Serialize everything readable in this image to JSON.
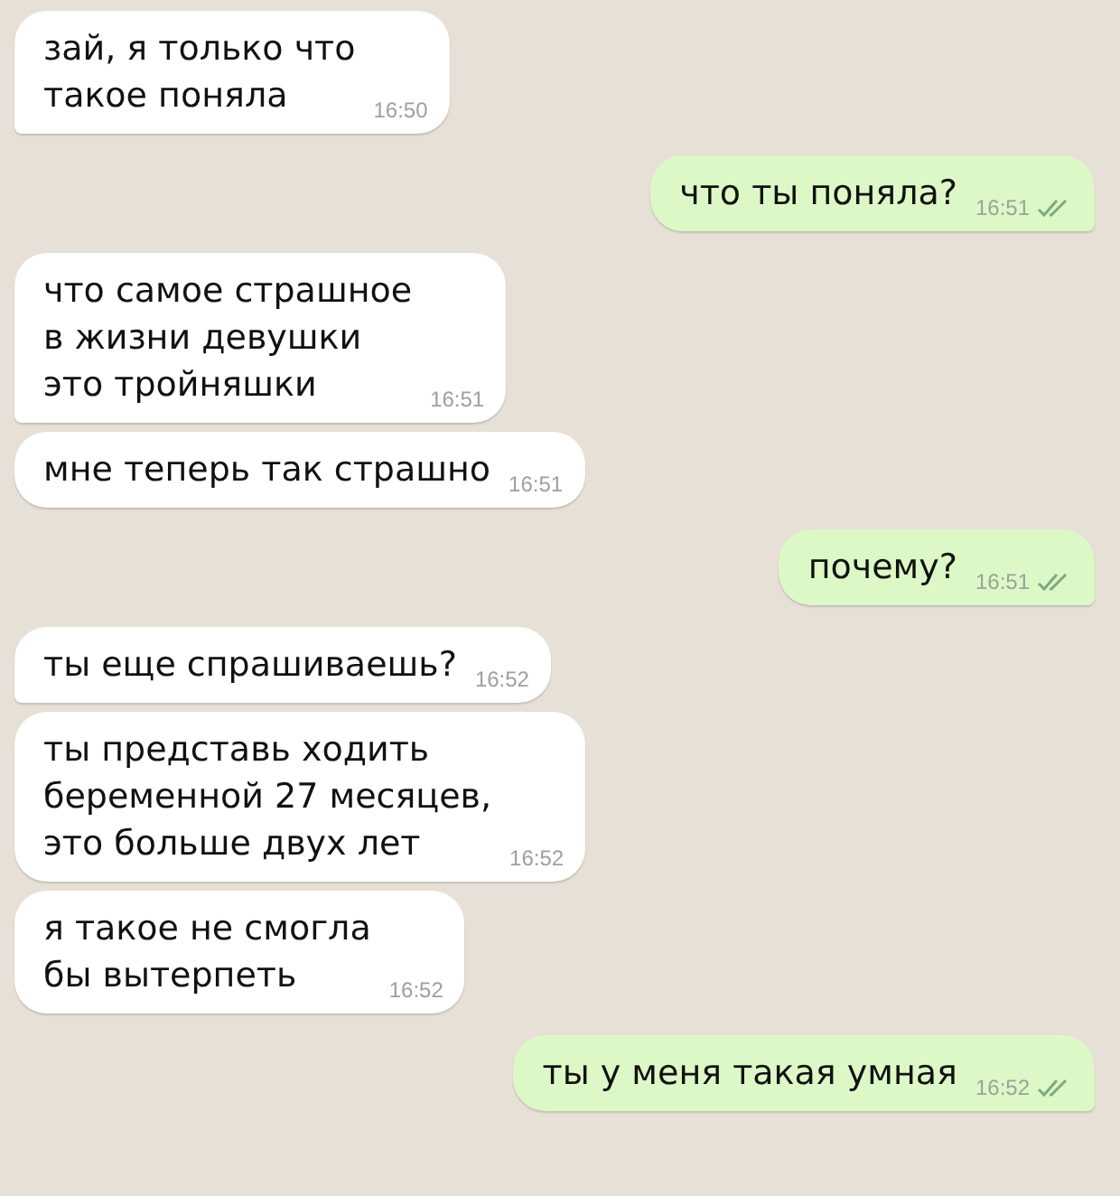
{
  "messages": [
    {
      "kind": "received",
      "tail": true,
      "lines": [
        "зай, я только что",
        "такое поняла"
      ],
      "time": "16:50"
    },
    {
      "kind": "sent",
      "tail": true,
      "lines": [
        "что ты поняла?"
      ],
      "time": "16:51",
      "read": true
    },
    {
      "kind": "received",
      "tail": true,
      "lines": [
        "что самое страшное",
        "в жизни девушки",
        "это тройняшки"
      ],
      "time": "16:51"
    },
    {
      "kind": "received",
      "tail": false,
      "lines": [
        "мне теперь так страшно"
      ],
      "time": "16:51"
    },
    {
      "kind": "sent",
      "tail": true,
      "lines": [
        "почему?"
      ],
      "time": "16:51",
      "read": true
    },
    {
      "kind": "received",
      "tail": true,
      "lines": [
        "ты еще спрашиваешь?"
      ],
      "time": "16:52"
    },
    {
      "kind": "received",
      "tail": false,
      "lines": [
        "ты представь ходить",
        "беременной 27 месяцев,",
        "это больше двух лет"
      ],
      "time": "16:52"
    },
    {
      "kind": "received",
      "tail": false,
      "lines": [
        "я такое не смогла",
        "бы вытерпеть"
      ],
      "time": "16:52"
    },
    {
      "kind": "sent",
      "tail": true,
      "lines": [
        "ты у меня такая умная"
      ],
      "time": "16:52",
      "read": true
    }
  ]
}
